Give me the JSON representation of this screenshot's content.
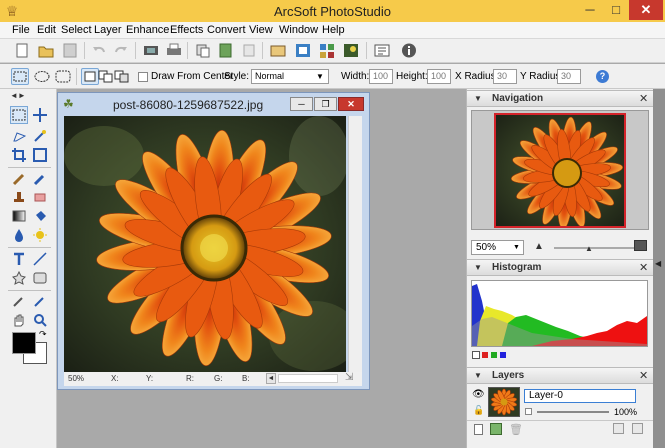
{
  "window": {
    "title": "ArcSoft PhotoStudio",
    "minimize": "─",
    "maximize": "□",
    "close": "✕"
  },
  "menu": [
    "File",
    "Edit",
    "Select",
    "Layer",
    "Enhance",
    "Effects",
    "Convert",
    "View",
    "Window",
    "Help"
  ],
  "toolbar": {
    "draw_from_center": "Draw From Center",
    "style_label": "Style:",
    "style_value": "Normal",
    "width_label": "Width:",
    "width_value": "100",
    "height_label": "Height:",
    "height_value": "100",
    "xradius_label": "X Radius:",
    "xradius_value": "30",
    "yradius_label": "Y Radius:",
    "yradius_value": "30",
    "help": "?"
  },
  "image_window": {
    "title": "post-86080-1259687522.jpg",
    "status": {
      "zoom": "50%",
      "x": "X:",
      "y": "Y:",
      "r": "R:",
      "g": "G:",
      "b": "B:"
    }
  },
  "navigation": {
    "title": "Navigation",
    "zoom": "50%"
  },
  "histogram": {
    "title": "Histogram"
  },
  "layers": {
    "title": "Layers",
    "layer_name": "Layer-0",
    "opacity": "100%"
  },
  "colors": {
    "titlebar": "#f6ca4a",
    "close": "#c7382d",
    "accent_frame": "#d4232a"
  }
}
